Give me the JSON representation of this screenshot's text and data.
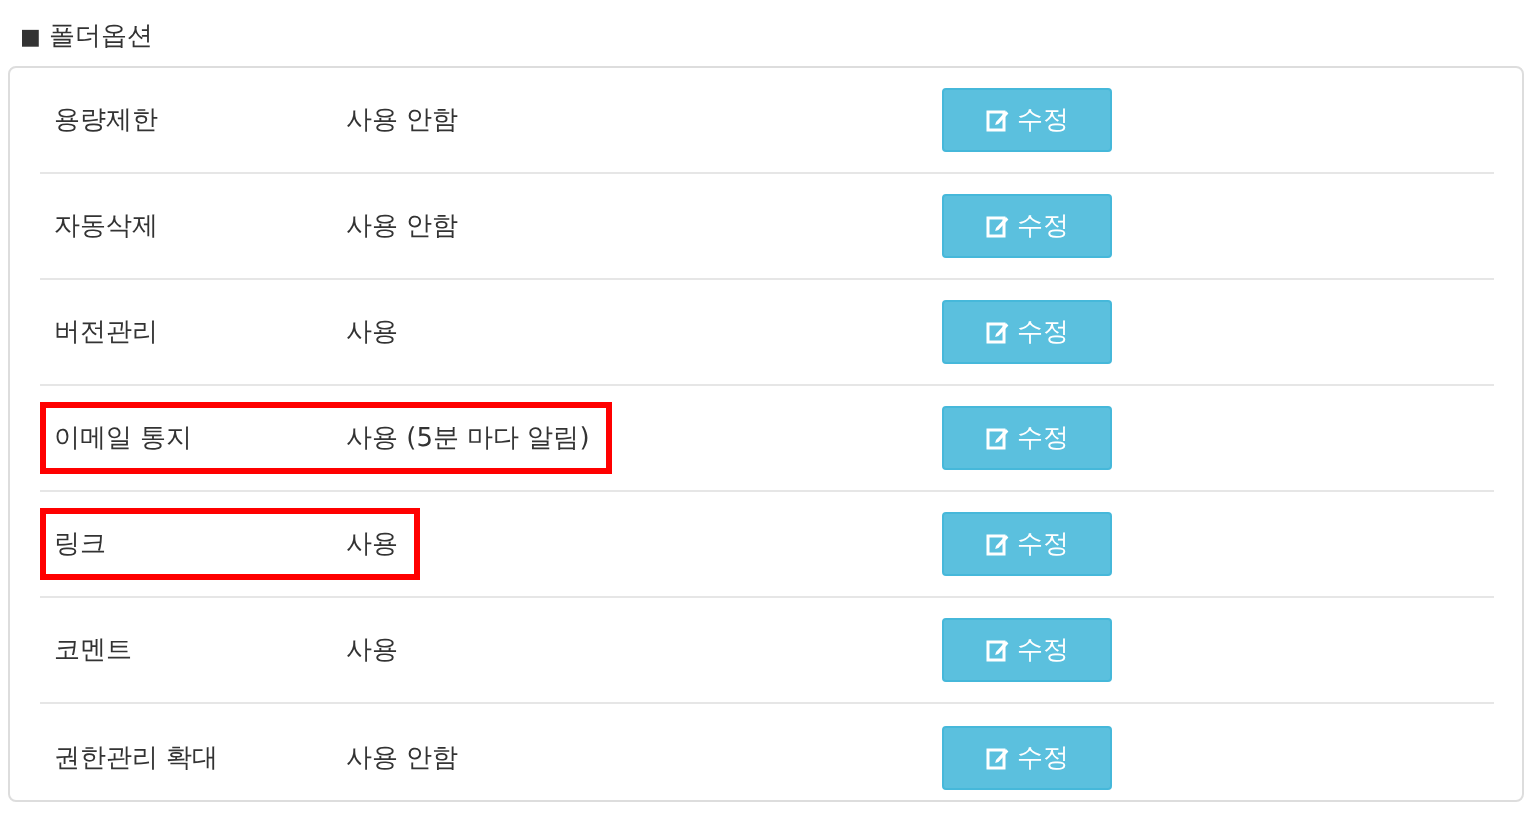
{
  "section": {
    "bullet": "■",
    "title": "폴더옵션"
  },
  "rows": [
    {
      "label": "용량제한",
      "value": "사용 안함",
      "button": "수정",
      "highlighted": false
    },
    {
      "label": "자동삭제",
      "value": "사용 안함",
      "button": "수정",
      "highlighted": false
    },
    {
      "label": "버전관리",
      "value": "사용",
      "button": "수정",
      "highlighted": false
    },
    {
      "label": "이메일 통지",
      "value": "사용 (5분 마다 알림)",
      "button": "수정",
      "highlighted": true
    },
    {
      "label": "링크",
      "value": "사용",
      "button": "수정",
      "highlighted": true
    },
    {
      "label": "코멘트",
      "value": "사용",
      "button": "수정",
      "highlighted": false
    },
    {
      "label": "권한관리 확대",
      "value": "사용 안함",
      "button": "수정",
      "highlighted": false
    }
  ]
}
